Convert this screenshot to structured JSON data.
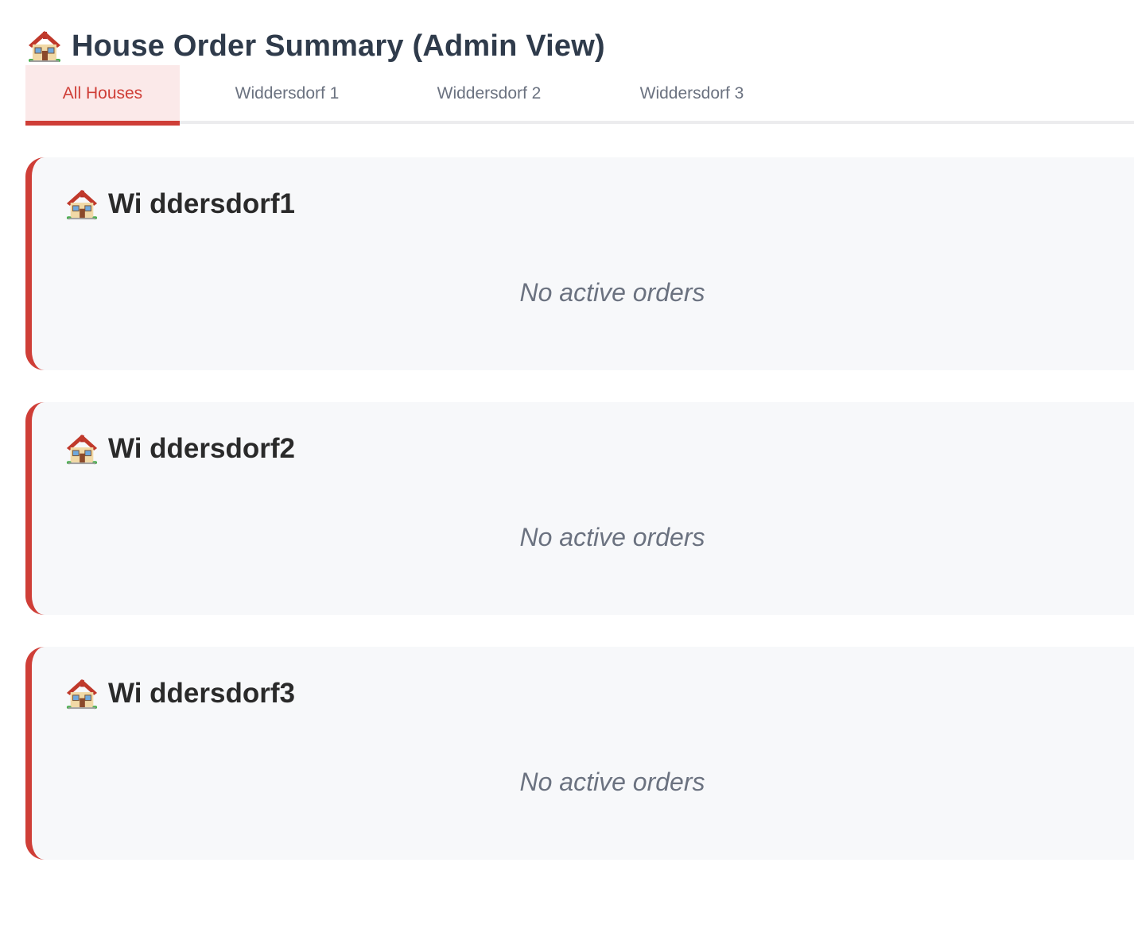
{
  "page": {
    "title": "House Order Summary (Admin View)",
    "title_icon": "house-icon"
  },
  "tabs": [
    {
      "label": "All Houses",
      "active": true
    },
    {
      "label": "Widdersdorf 1",
      "active": false
    },
    {
      "label": "Widdersdorf 2",
      "active": false
    },
    {
      "label": "Widdersdorf 3",
      "active": false
    }
  ],
  "houses": [
    {
      "name": "Wi ddersdorf1",
      "icon": "house-icon",
      "empty_text": "No active orders"
    },
    {
      "name": "Wi ddersdorf2",
      "icon": "house-icon",
      "empty_text": "No active orders"
    },
    {
      "name": "Wi ddersdorf3",
      "icon": "house-icon",
      "empty_text": "No active orders"
    }
  ],
  "colors": {
    "accent": "#cf3e37",
    "active_tab_bg": "#fbe9e9",
    "card_bg": "#f7f8fa",
    "title_text": "#2f3b4b",
    "muted_text": "#6b7280"
  }
}
